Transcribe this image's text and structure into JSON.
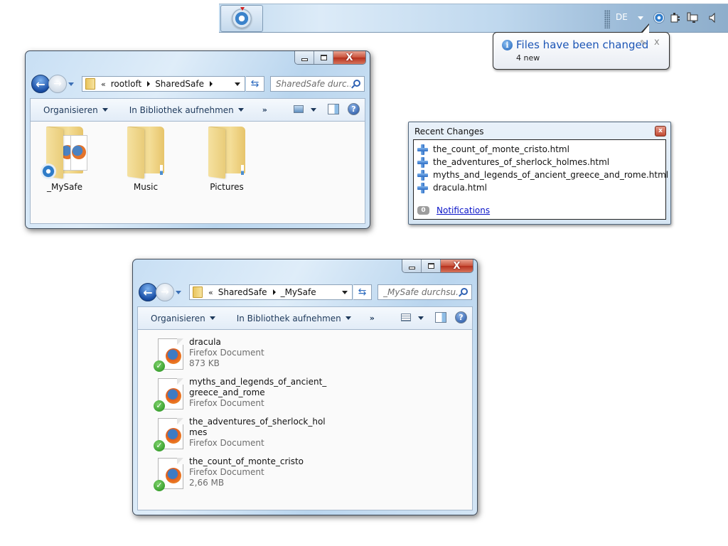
{
  "taskbar": {
    "app_button": "SharedSafe",
    "language": "DE",
    "tray_icons": [
      "sharedsafe-icon",
      "power-icon",
      "network-icon",
      "volume-icon"
    ]
  },
  "balloon": {
    "icon": "info-icon",
    "title": "Files have been changed",
    "text": "4 new",
    "options_glyph": "✎",
    "close_glyph": "x"
  },
  "window1": {
    "path": {
      "overflow": "«",
      "crumbs": [
        "rootloft",
        "SharedSafe"
      ]
    },
    "search_placeholder": "SharedSafe durc...",
    "toolbar": {
      "organize": "Organisieren",
      "library": "In Bibliothek aufnehmen",
      "more": "»"
    },
    "items": [
      {
        "name": "_MySafe",
        "type": "safe-folder"
      },
      {
        "name": "Music",
        "type": "folder"
      },
      {
        "name": "Pictures",
        "type": "folder"
      }
    ]
  },
  "window2": {
    "path": {
      "overflow": "«",
      "crumbs": [
        "SharedSafe",
        "_MySafe"
      ]
    },
    "search_placeholder": "_MySafe durchsu...",
    "toolbar": {
      "organize": "Organisieren",
      "library": "In Bibliothek aufnehmen",
      "more": "»"
    },
    "files": [
      {
        "name": "dracula",
        "type": "Firefox Document",
        "size": "873 KB"
      },
      {
        "name": "myths_and_legends_of_ancient_greece_and_rome",
        "type": "Firefox Document",
        "size": ""
      },
      {
        "name": "the_adventures_of_sherlock_holmes",
        "type": "Firefox Document",
        "size": ""
      },
      {
        "name": "the_count_of_monte_cristo",
        "type": "Firefox Document",
        "size": "2,66 MB"
      }
    ]
  },
  "recent_changes": {
    "title": "Recent Changes",
    "close_glyph": "x",
    "items": [
      "the_count_of_monte_cristo.html",
      "the_adventures_of_sherlock_holmes.html",
      "myths_and_legends_of_ancient_greece_and_rome.html",
      "dracula.html"
    ],
    "notification_count": "0",
    "notifications_link": "Notifications"
  },
  "caption": {
    "close_glyph": "X",
    "back_glyph": "←",
    "forward_glyph": "→",
    "refresh_glyph": "⇆",
    "help_glyph": "?"
  }
}
